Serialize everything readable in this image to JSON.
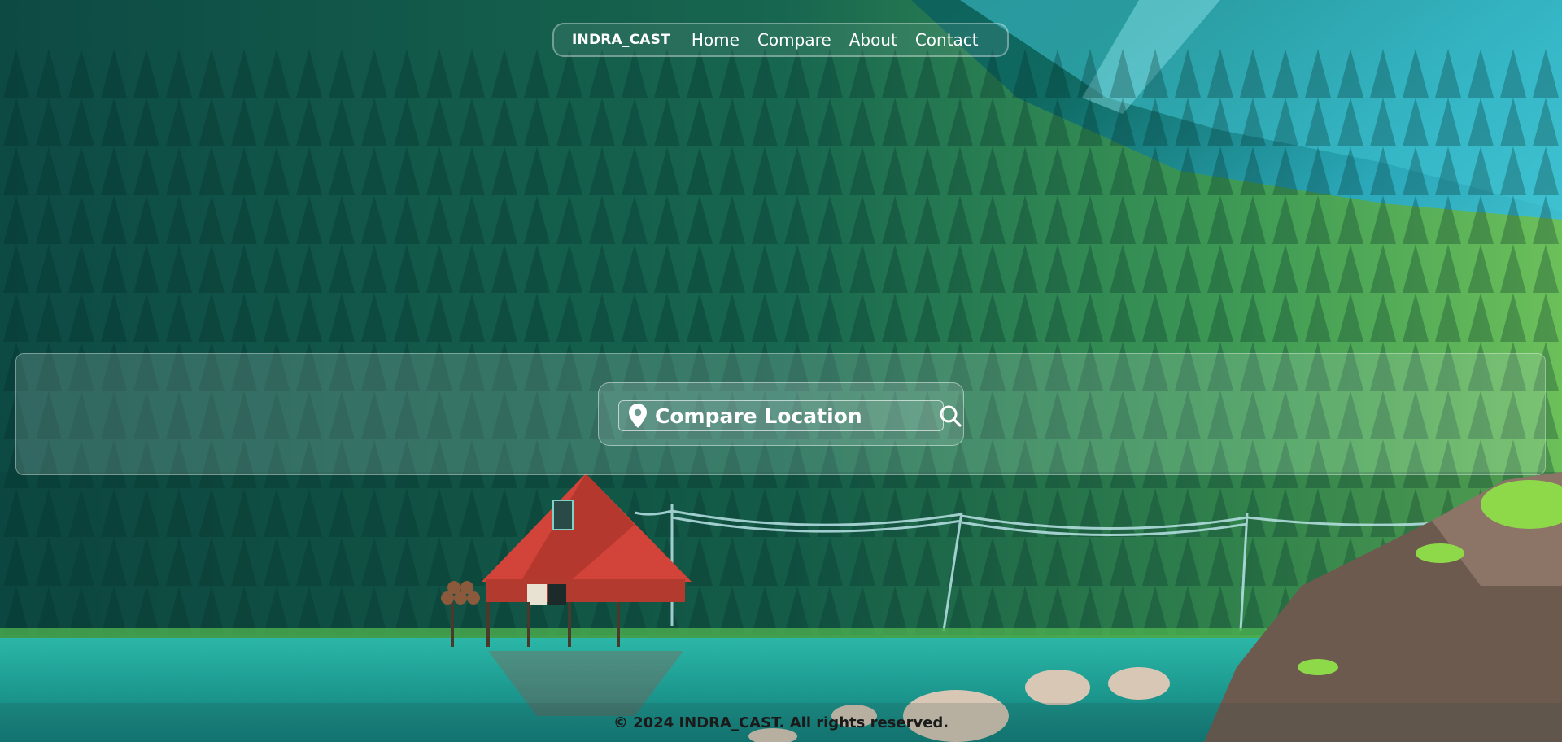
{
  "nav": {
    "brand": "INDRA_CAST",
    "links": [
      "Home",
      "Compare",
      "About",
      "Contact"
    ]
  },
  "search": {
    "placeholder": "Compare Location"
  },
  "footer": {
    "text": "© 2024 INDRA_CAST. All rights reserved."
  },
  "colors": {
    "text": "#ffffff",
    "footer_text": "#1a1a1a",
    "cabin": "#c0392b",
    "water": "#2fb7a3"
  },
  "icons": {
    "location": "map-pin-icon",
    "search": "search-icon"
  }
}
